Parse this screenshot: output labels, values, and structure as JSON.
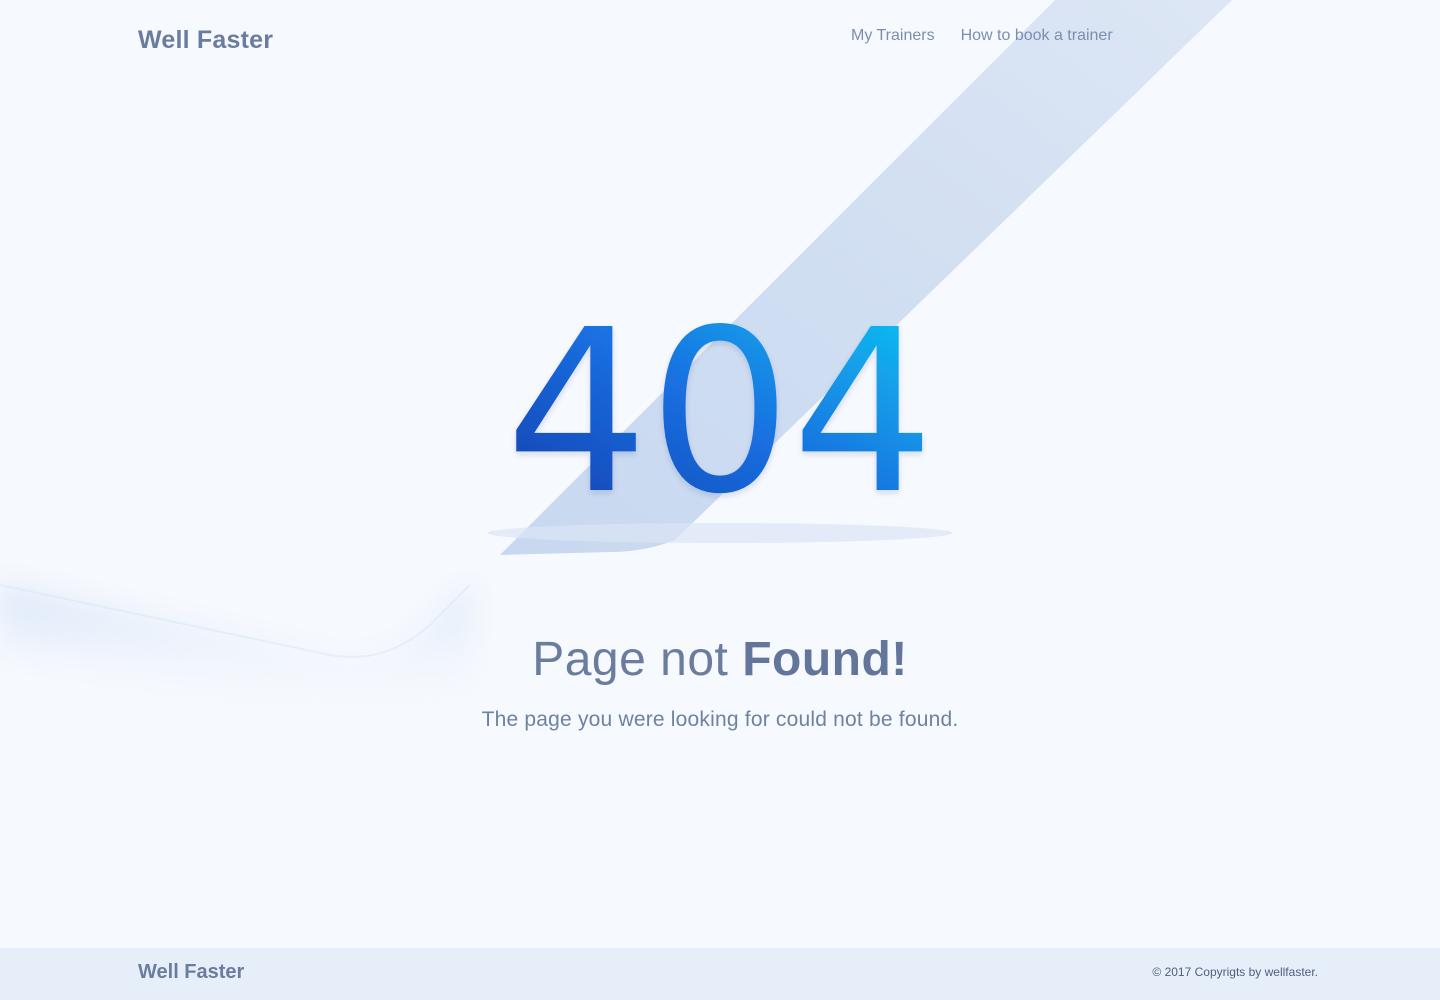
{
  "header": {
    "logo": "Well Faster",
    "nav": [
      {
        "label": "My Trainers"
      },
      {
        "label": "How to book a trainer"
      }
    ]
  },
  "hero": {
    "code": "404",
    "title_light": "Page not ",
    "title_bold": "Found!",
    "subtitle": "The page you were looking for could not be found."
  },
  "footer": {
    "logo": "Well Faster",
    "copyright": "© 2017  Copyrigts by wellfaster."
  },
  "colors": {
    "background": "#f6f9fe",
    "text": "#6a7d9e",
    "gradient_start": "#1237a8",
    "gradient_end": "#0bc4f0",
    "footer_bg": "#e6eefa"
  }
}
